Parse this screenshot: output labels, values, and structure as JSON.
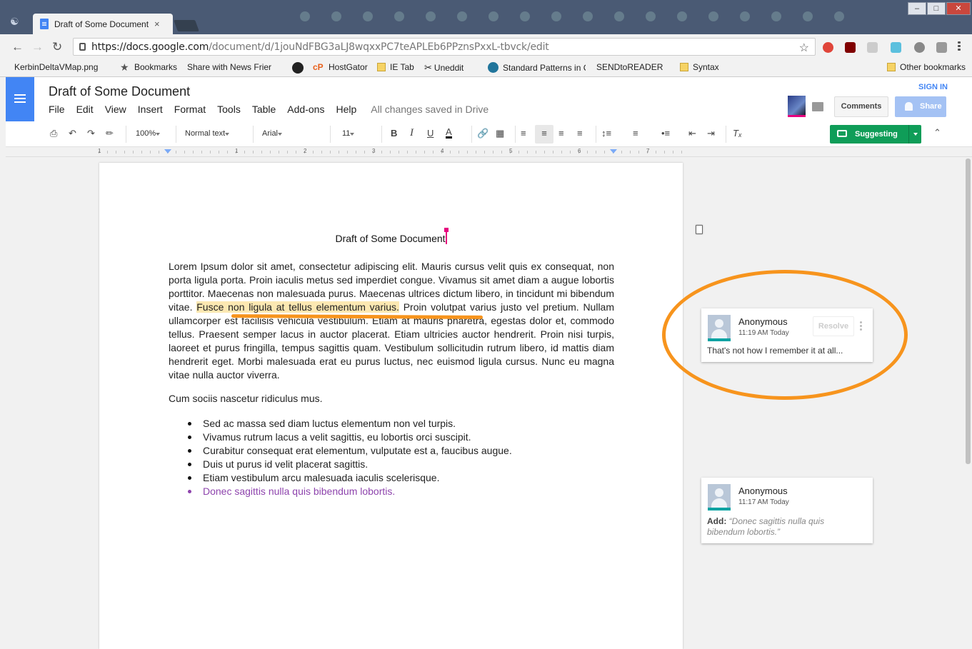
{
  "browser": {
    "tab_title": "Draft of Some Document",
    "tab_close": "×",
    "url_host": "https://docs.google.com",
    "url_path": "/document/d/1jouNdFBG3aLJ8wqxxPC7teAPLEb6PPznsPxxL-tbvck/edit",
    "bookmarks": [
      {
        "label": "KerbinDeltaVMap.png",
        "icon": "page-icon"
      },
      {
        "label": "Bookmarks",
        "icon": "star-icon"
      },
      {
        "label": "Share with News Frier",
        "icon": "page-icon"
      },
      {
        "label": "",
        "icon": "skull-icon"
      },
      {
        "label": "HostGator",
        "icon": "hostgator-icon"
      },
      {
        "label": "IE Tab",
        "icon": "folder-icon"
      },
      {
        "label": "Uneddit",
        "icon": "scissors-icon"
      },
      {
        "label": "Standard Patterns in C",
        "icon": "wordpress-icon"
      },
      {
        "label": "SENDtoREADER",
        "icon": "page-icon"
      },
      {
        "label": "Syntax",
        "icon": "folder-icon"
      },
      {
        "label": "Other bookmarks",
        "icon": "folder-icon"
      }
    ]
  },
  "docs": {
    "title": "Draft of Some Document",
    "menu": [
      "File",
      "Edit",
      "View",
      "Insert",
      "Format",
      "Tools",
      "Table",
      "Add-ons",
      "Help"
    ],
    "save_status": "All changes saved in Drive",
    "sign_in": "SIGN IN",
    "comments_button": "Comments",
    "share_button": "Share",
    "toolbar": {
      "zoom": "100%",
      "style": "Normal text",
      "font": "Arial",
      "size": "11",
      "mode": "Suggesting",
      "bold": "B",
      "italic": "I",
      "underline": "U",
      "text_color": "A"
    },
    "ruler_numbers": [
      "1",
      "1",
      "2",
      "3",
      "4",
      "5",
      "6",
      "7"
    ]
  },
  "document": {
    "heading": "Draft of Some Document",
    "para1_before": "Lorem Ipsum dolor sit amet, consectetur adipiscing elit. Mauris cursus velit quis ex consequat, non porta ligula porta. Proin iaculis metus sed imperdiet congue. Vivamus sit amet diam a augue lobortis porttitor. Maecenas non malesuada purus. Maecenas ultrices dictum libero, in tincidunt mi bibendum vitae. ",
    "para1_highlight": "Fusce non ligula at tellus elementum varius.",
    "para1_after": " Proin volutpat varius justo vel pretium. Nullam ullamcorper est facilisis vehicula vestibulum. Etiam at mauris pharetra, egestas dolor et, commodo tellus. Praesent semper lacus in auctor placerat. Etiam ultricies auctor hendrerit. Proin nisi turpis, laoreet et purus fringilla, tempus sagittis quam. Vestibulum sollicitudin rutrum libero, id mattis diam hendrerit eget. Morbi malesuada erat eu purus luctus, nec euismod ligula cursus. Nunc eu magna vitae nulla auctor viverra.",
    "para2": "Cum sociis nascetur ridiculus mus.",
    "bullets": [
      "Sed ac massa sed diam luctus elementum non vel turpis.",
      "Vivamus rutrum lacus a velit sagittis, eu lobortis orci suscipit.",
      "Curabitur consequat erat elementum, vulputate est a, faucibus augue.",
      "Duis ut purus id velit placerat sagittis.",
      "Etiam vestibulum arcu malesuada iaculis scelerisque."
    ],
    "suggested_bullet": "Donec sagittis nulla quis bibendum lobortis."
  },
  "comments": [
    {
      "author": "Anonymous",
      "time": "11:19 AM Today",
      "text": "That's not how I remember it at all...",
      "resolve": "Resolve"
    },
    {
      "author": "Anonymous",
      "time": "11:17 AM Today",
      "add_label": "Add:",
      "add_text": "“Donec sagittis nulla quis bibendum lobortis.”"
    }
  ],
  "colors": {
    "docs_blue": "#4285f4",
    "suggest_green": "#0f9d58",
    "highlight": "#fce8b2",
    "annotation_orange": "#f7941d",
    "suggestion_purple": "#8e44ad"
  }
}
